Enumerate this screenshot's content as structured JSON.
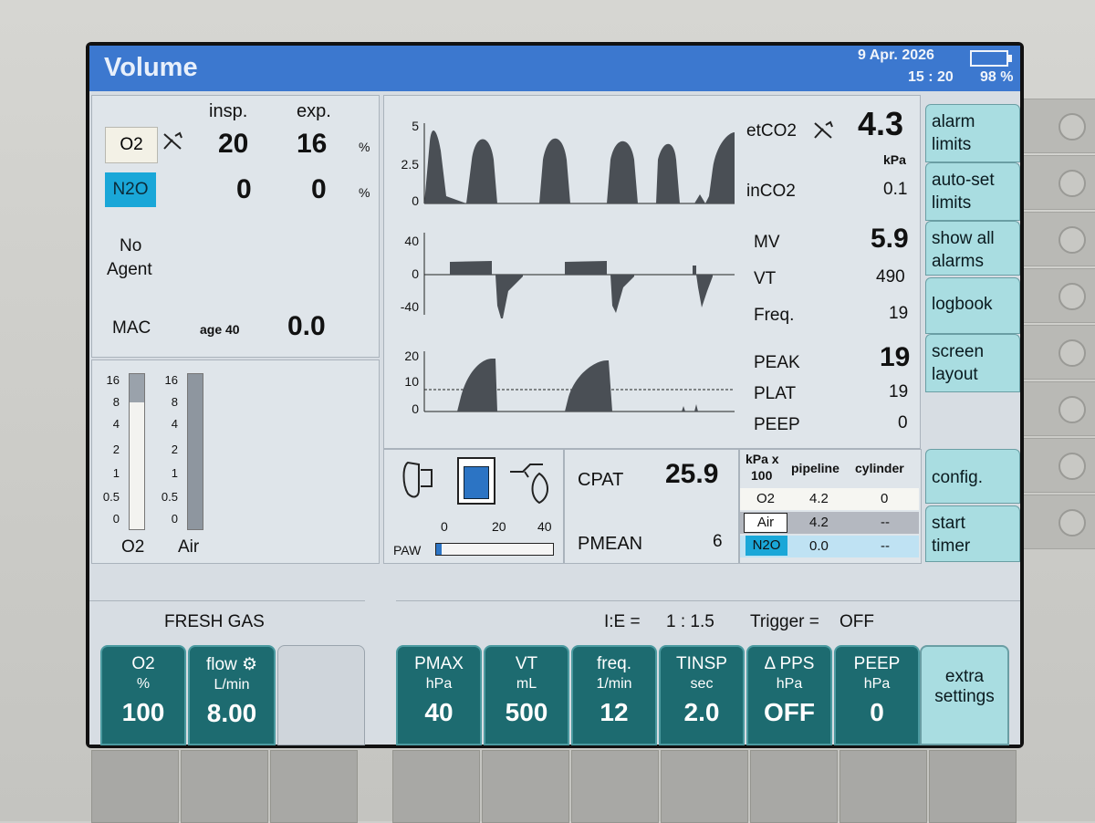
{
  "header": {
    "title": "Volume",
    "date": "9 Apr. 2026",
    "time": "15 : 20",
    "battery": "98 %"
  },
  "gases": {
    "col_insp": "insp.",
    "col_exp": "exp.",
    "o2_label": "O2",
    "o2_insp": "20",
    "o2_exp": "16",
    "o2_unit": "%",
    "n2o_label": "N2O",
    "n2o_insp": "0",
    "n2o_exp": "0",
    "n2o_unit": "%",
    "agent_line1": "No",
    "agent_line2": "Agent",
    "mac_label": "MAC",
    "age_label": "age 40",
    "mac_value": "0.0"
  },
  "flowmeters": {
    "o2_label": "O2",
    "air_label": "Air",
    "scale": [
      "16",
      "8",
      "4",
      "2",
      "1",
      "0.5",
      "0"
    ],
    "o2_fill": 0.82,
    "air_fill": 0.0
  },
  "waveforms": {
    "co2_ticks": [
      "5",
      "2.5",
      "0"
    ],
    "flow_ticks": [
      "40",
      "0",
      "-40"
    ],
    "paw_ticks": [
      "20",
      "10",
      "0"
    ]
  },
  "right_values": {
    "etco2_label": "etCO2",
    "etco2_value": "4.3",
    "etco2_unit": "kPa",
    "inco2_label": "inCO2",
    "inco2_value": "0.1",
    "mv_label": "MV",
    "mv_value": "5.9",
    "vt_label": "VT",
    "vt_value": "490",
    "freq_label": "Freq.",
    "freq_value": "19",
    "peak_label": "PEAK",
    "peak_value": "19",
    "plat_label": "PLAT",
    "plat_value": "19",
    "peep_label": "PEEP",
    "peep_value": "0"
  },
  "paw": {
    "label": "PAW",
    "ticks": [
      "0",
      "20",
      "40"
    ],
    "level": 0.05
  },
  "compliance": {
    "cpat_label": "CPAT",
    "cpat_value": "25.9",
    "pmean_label": "PMEAN",
    "pmean_value": "6"
  },
  "supply": {
    "unit_line1": "kPa x",
    "unit_line2": "100",
    "col_pipeline": "pipeline",
    "col_cylinder": "cylinder",
    "rows": [
      {
        "gas": "O2",
        "pipeline": "4.2",
        "cylinder": "0"
      },
      {
        "gas": "Air",
        "pipeline": "4.2",
        "cylinder": "--"
      },
      {
        "gas": "N2O",
        "pipeline": "0.0",
        "cylinder": "--"
      }
    ]
  },
  "softkeys": {
    "alarm_limits": [
      "alarm",
      "limits"
    ],
    "autoset": [
      "auto-set",
      "limits"
    ],
    "show_alarms": [
      "show all",
      "alarms"
    ],
    "logbook": "logbook",
    "screen_layout": [
      "screen",
      "layout"
    ],
    "config": "config.",
    "start_timer": [
      "start",
      "timer"
    ]
  },
  "fresh_gas": {
    "title": "FRESH GAS",
    "o2_label": "O2",
    "o2_unit": "%",
    "o2_value": "100",
    "flow_label": "flow",
    "flow_unit": "L/min",
    "flow_value": "8.00"
  },
  "status": {
    "ie_label": "I:E =",
    "ie_value": "1 : 1.5",
    "trigger_label": "Trigger =",
    "trigger_value": "OFF"
  },
  "settings": [
    {
      "label": "PMAX",
      "unit": "hPa",
      "value": "40"
    },
    {
      "label": "VT",
      "unit": "mL",
      "value": "500"
    },
    {
      "label": "freq.",
      "unit": "1/min",
      "value": "12"
    },
    {
      "label": "TINSP",
      "unit": "sec",
      "value": "2.0"
    },
    {
      "label": "Δ PPS",
      "unit": "hPa",
      "value": "OFF"
    },
    {
      "label": "PEEP",
      "unit": "hPa",
      "value": "0"
    }
  ],
  "extra_settings": [
    "extra",
    "settings"
  ],
  "colors": {
    "accent_blue": "#3c78cf",
    "teal": "#1d6b70",
    "softkey": "#a9dde1",
    "n2o_chip": "#1aa7d8"
  }
}
